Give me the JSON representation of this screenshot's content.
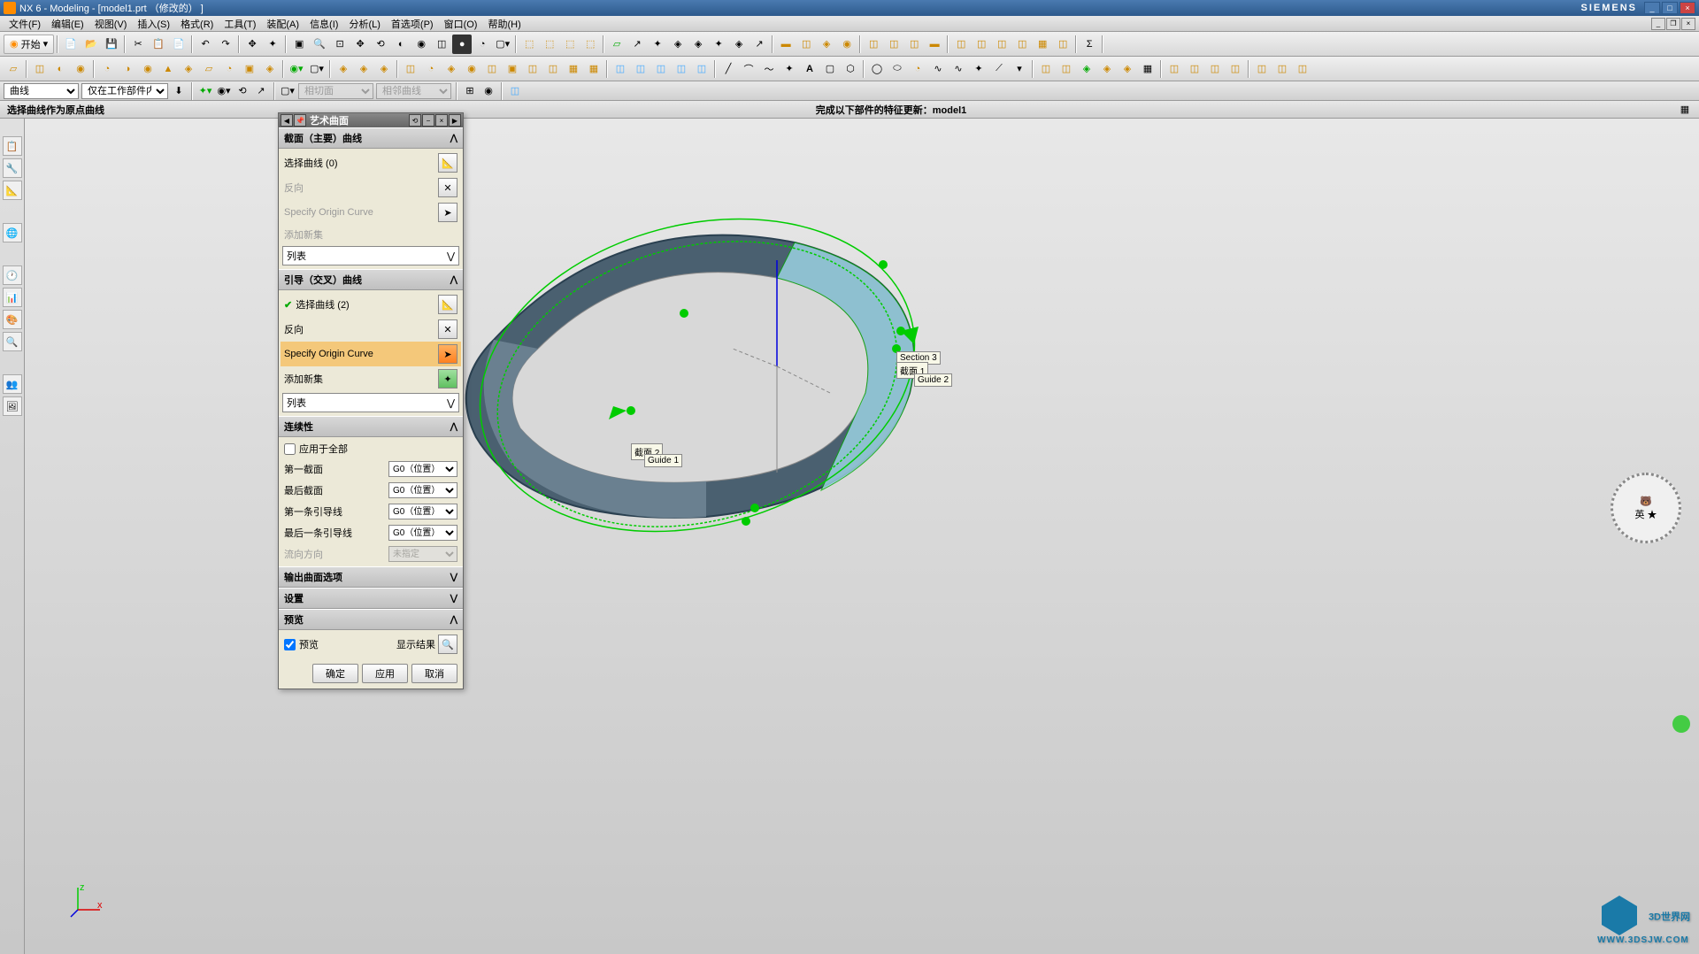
{
  "title": "NX 6 - Modeling - [model1.prt （修改的） ]",
  "siemens": "SIEMENS",
  "menu": [
    "文件(F)",
    "编辑(E)",
    "视图(V)",
    "插入(S)",
    "格式(R)",
    "工具(T)",
    "装配(A)",
    "信息(I)",
    "分析(L)",
    "首选项(P)",
    "窗口(O)",
    "帮助(H)"
  ],
  "start_label": "开始",
  "filter": {
    "sel1": "曲线",
    "sel2": "仅在工作部件内部",
    "sel3": "相切面",
    "sel4": "相邻曲线"
  },
  "status_left": "选择曲线作为原点曲线",
  "status_center": "完成以下部件的特征更新：model1",
  "dialog": {
    "title": "艺术曲面",
    "sec1": "截面（主要）曲线",
    "sel_curve0": "选择曲线 (0)",
    "reverse": "反向",
    "origin_curve": "Specify Origin Curve",
    "add_set": "添加新集",
    "list": "列表",
    "sec2": "引导（交叉）曲线",
    "sel_curve2": "选择曲线 (2)",
    "sec3": "连续性",
    "apply_all": "应用于全部",
    "first_section": "第一截面",
    "last_section": "最后截面",
    "first_guide": "第一条引导线",
    "last_guide": "最后一条引导线",
    "flow_dir": "流向方向",
    "g0": "G0（位置）",
    "unspecified": "未指定",
    "sec4": "输出曲面选项",
    "sec5": "设置",
    "sec6": "预览",
    "preview_chk": "预览",
    "show_result": "显示结果",
    "ok": "确定",
    "apply": "应用",
    "cancel": "取消"
  },
  "labels": {
    "section3": "Section 3",
    "section1": "截面 1",
    "guide2": "Guide 2",
    "section2": "截面 2",
    "guide1": "Guide 1"
  },
  "watermark": "3D世界网",
  "watermark_sub": "WWW.3DSJW.COM"
}
